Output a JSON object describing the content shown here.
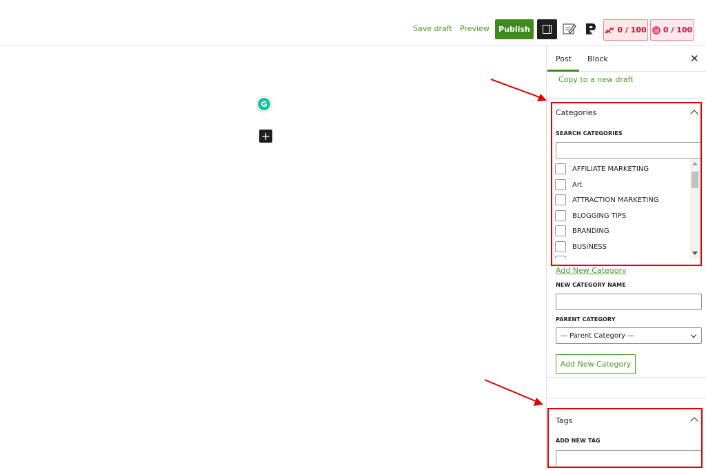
{
  "topbar": {
    "save_draft": "Save draft",
    "preview": "Preview",
    "publish": "Publish",
    "score_seo": "0 / 100",
    "score_readability": "0 / 100",
    "icons": [
      "sidebar-toggle-icon",
      "edit-note-icon",
      "plugin-logo-icon",
      "seo-score-icon",
      "readability-score-icon"
    ]
  },
  "canvas": {
    "grammarly_glyph": "G",
    "add_block_glyph": "+"
  },
  "sidebar": {
    "tabs": {
      "post": "Post",
      "block": "Block"
    },
    "close_glyph": "✕",
    "copy_draft": "Copy to a new draft",
    "categories": {
      "title": "Categories",
      "search_label": "SEARCH CATEGORIES",
      "search_value": "",
      "items": [
        "AFFILIATE MARKETING",
        "Art",
        "ATTRACTION MARKETING",
        "BLOGGING TIPS",
        "BRANDING",
        "BUSINESS"
      ],
      "add_new_link": "Add New Category",
      "new_name_label": "NEW CATEGORY NAME",
      "new_name_value": "",
      "parent_label": "PARENT CATEGORY",
      "parent_selected": "— Parent Category —",
      "add_button": "Add New Category"
    },
    "tags": {
      "title": "Tags",
      "add_label": "ADD NEW TAG",
      "add_value": ""
    }
  },
  "colors": {
    "accent_green": "#3f8a1e",
    "link_green": "#4c9a2a",
    "annotation_red": "#e00000",
    "score_red": "#c8102e"
  }
}
